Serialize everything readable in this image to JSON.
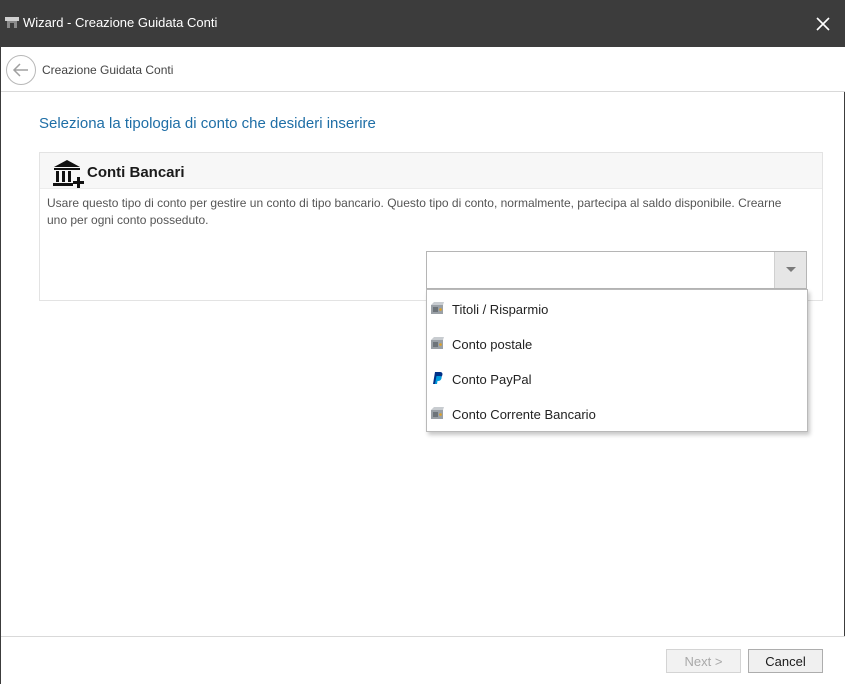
{
  "window": {
    "title": "Wizard - Creazione Guidata Conti",
    "close_icon": "close-icon"
  },
  "nav": {
    "back_icon": "back-arrow-icon",
    "title": "Creazione Guidata Conti"
  },
  "main": {
    "heading": "Seleziona la tipologia di conto che desideri inserire",
    "heading_color": "#1e6ea6",
    "card": {
      "icon": "bank-add-icon",
      "title": "Conti Bancari",
      "description": "Usare questo tipo di conto per gestire un conto di tipo bancario. Questo tipo di conto, normalmente, partecipa al saldo disponibile. Crearne uno per ogni conto posseduto."
    },
    "combo": {
      "value": "",
      "options": [
        {
          "label": "Titoli / Risparmio",
          "icon": "safe-icon"
        },
        {
          "label": "Conto postale",
          "icon": "safe-icon"
        },
        {
          "label": "Conto PayPal",
          "icon": "paypal-icon"
        },
        {
          "label": "Conto Corrente Bancario",
          "icon": "safe-icon"
        }
      ]
    }
  },
  "footer": {
    "next_label": "Next >",
    "cancel_label": "Cancel"
  }
}
